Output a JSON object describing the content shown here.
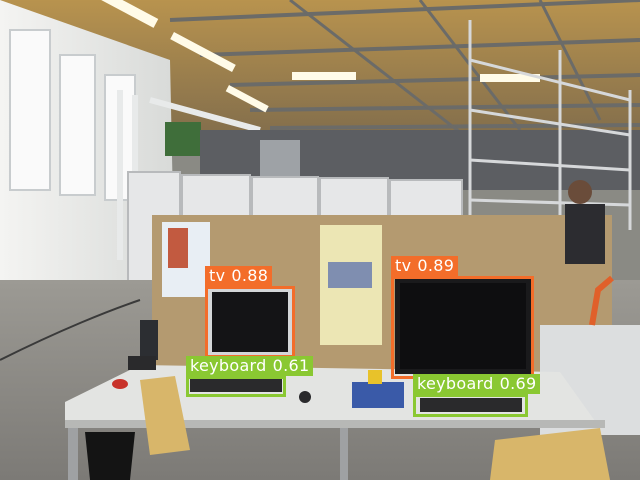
{
  "image": {
    "kind": "object-detection-result",
    "description_colors": {
      "tv_box": "#f36d2a",
      "keyboard_box": "#8ac832",
      "label_text": "#ffffff"
    }
  },
  "detections": [
    {
      "label": "tv",
      "score": "0.88",
      "color": "#f36d2a"
    },
    {
      "label": "keyboard",
      "score": "0.61",
      "color": "#8ac832"
    },
    {
      "label": "tv",
      "score": "0.89",
      "color": "#f36d2a"
    },
    {
      "label": "keyboard",
      "score": "0.69",
      "color": "#8ac832"
    }
  ]
}
